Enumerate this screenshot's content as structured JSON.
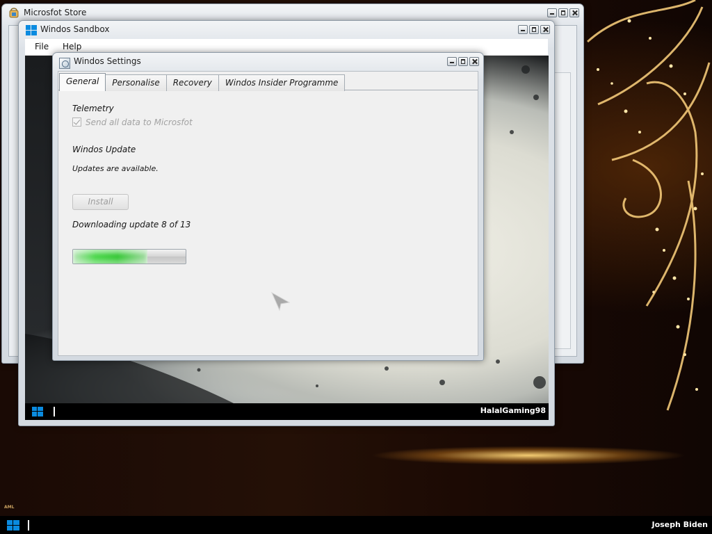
{
  "desktop": {
    "user_name": "Joseph Biden",
    "watermark": "AML"
  },
  "store_window": {
    "title": "Microsfot Store"
  },
  "sandbox_window": {
    "title": "Windos Sandbox",
    "menu": [
      "File",
      "Help"
    ],
    "vm_user_name": "HalalGaming98"
  },
  "settings_window": {
    "title": "Windos Settings",
    "tabs": [
      "General",
      "Personalise",
      "Recovery",
      "Windos Insider Programme"
    ],
    "active_tab": "General",
    "telemetry": {
      "heading": "Telemetry",
      "checkbox_label": "Send all data to Microsfot",
      "checked": true,
      "enabled": false
    },
    "update": {
      "heading": "Windos Update",
      "status": "Updates are available.",
      "install_label": "Install",
      "install_enabled": false,
      "progress_text": "Downloading update 8 of 13",
      "progress_fraction": 0.66
    }
  },
  "colors": {
    "accent_blue": "#0a8be0",
    "progress_green": "#38c838"
  }
}
